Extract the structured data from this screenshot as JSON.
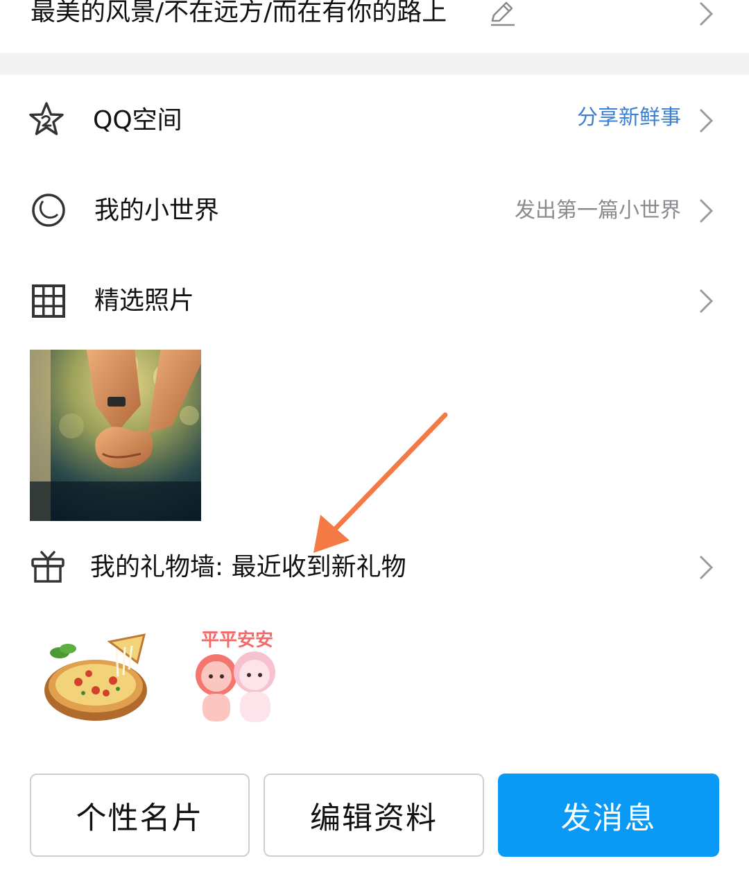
{
  "signature": {
    "text": "最美的风景/不在远方/而在有你的路上"
  },
  "rows": {
    "qzone": {
      "label": "QQ空间",
      "sub": "分享新鲜事",
      "sub_color": "#3a7fd5"
    },
    "world": {
      "label": "我的小世界",
      "sub": "发出第一篇小世界",
      "sub_color": "#8a8a8f"
    },
    "photos": {
      "label": "精选照片"
    },
    "gifts": {
      "label": "我的礼物墙: 最近收到新礼物"
    }
  },
  "gift_items": [
    {
      "name": "pizza"
    },
    {
      "name": "平平安安",
      "caption": "平平安安"
    }
  ],
  "buttons": {
    "card": "个性名片",
    "edit": "编辑资料",
    "message": "发消息"
  },
  "colors": {
    "primary": "#0a9af6",
    "link": "#3a7fd5",
    "annotation_arrow": "#f47a45"
  }
}
